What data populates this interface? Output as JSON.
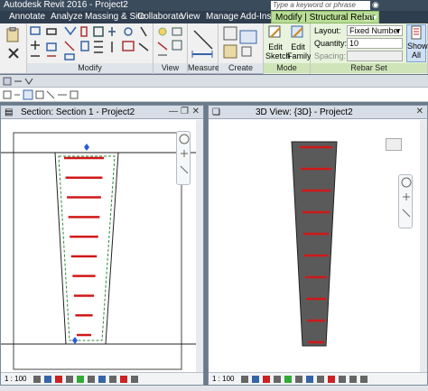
{
  "app": {
    "title": "Autodesk Revit 2016 -    Project2",
    "search_placeholder": "Type a keyword or phrase",
    "search_icon": "binoculars-icon"
  },
  "tabs": [
    {
      "label": "Annotate"
    },
    {
      "label": "Analyze"
    },
    {
      "label": "Massing & Site"
    },
    {
      "label": "Collaborate"
    },
    {
      "label": "View"
    },
    {
      "label": "Manage"
    },
    {
      "label": "Add-Ins"
    },
    {
      "label": "Modify | Structural Rebar"
    }
  ],
  "tab_extra": "▢ ▾",
  "ribbon": {
    "groups": {
      "modify": "Modify",
      "view": "View",
      "measure": "Measure",
      "create": "Create",
      "mode": "Mode",
      "rebar_set": "Rebar Set"
    },
    "edit_sketch": {
      "line1": "Edit",
      "line2": "Sketch"
    },
    "edit_family": {
      "line1": "Edit",
      "line2": "Family"
    },
    "show_all": {
      "line1": "Show",
      "line2": "All"
    },
    "layout": {
      "label": "Layout:",
      "value": "Fixed Number"
    },
    "quantity": {
      "label": "Quantity:",
      "value": "10"
    },
    "spacing": {
      "label": "Spacing:",
      "value": ""
    }
  },
  "views": {
    "section": {
      "title": "Section: Section 1 - Project2",
      "scale": "1 : 100"
    },
    "view3d": {
      "title": "3D View: {3D} - Project2",
      "scale": "1 : 100"
    }
  },
  "colors": {
    "rebar": "#d01818",
    "element_fill": "#5a5a5a",
    "contextual_tab": "#b8dd94"
  }
}
